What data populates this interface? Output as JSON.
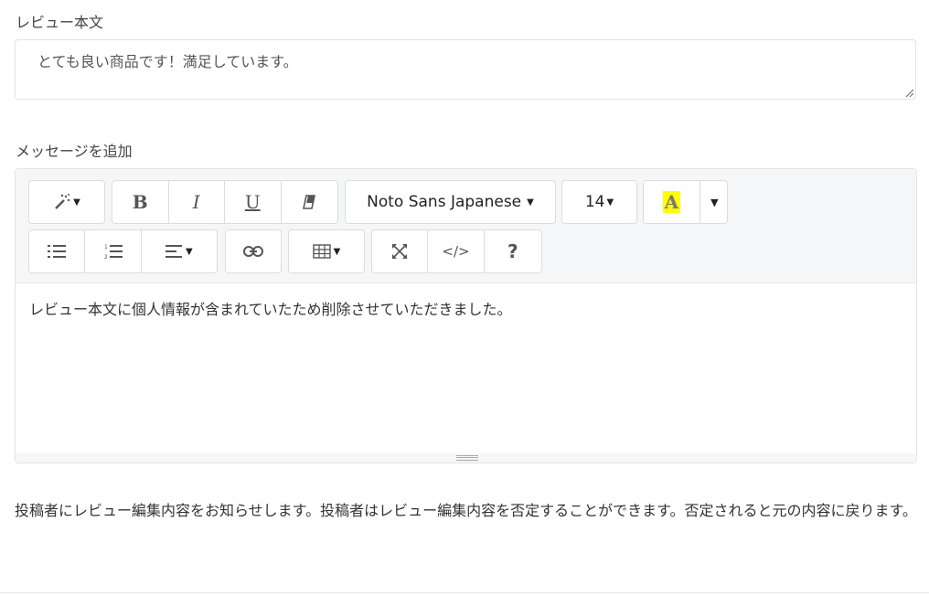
{
  "review": {
    "label": "レビュー本文",
    "value": "とても良い商品です！満足しています。"
  },
  "message": {
    "label": "メッセージを追加",
    "toolbar": {
      "font_name": "Noto Sans Japanese",
      "font_size": "14",
      "color_letter": "A",
      "help_label": "?",
      "code_label": "</>",
      "highlight_color": "#ffff00"
    },
    "body": "レビュー本文に個人情報が含まれていたため削除させていただきました。"
  },
  "notice": "投稿者にレビュー編集内容をお知らせします。投稿者はレビュー編集内容を否定することができます。否定されると元の内容に戻ります。"
}
